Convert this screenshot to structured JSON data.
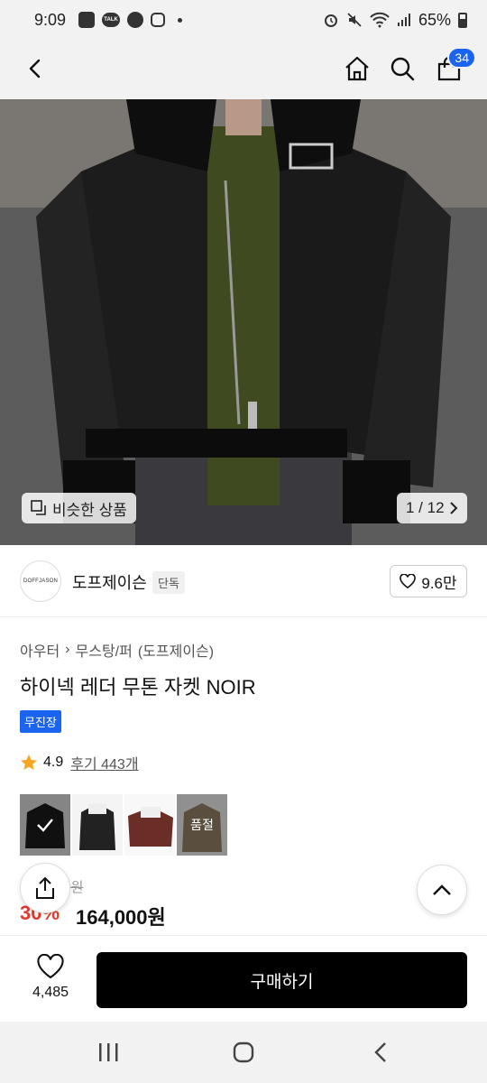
{
  "status": {
    "time": "9:09",
    "talk_label": "TALK",
    "battery": "65%"
  },
  "header": {
    "cart_count": "34"
  },
  "hero": {
    "similar_label": "비슷한 상품",
    "page_indicator": "1 / 12"
  },
  "brand": {
    "logo_text": "DOFFJASON",
    "name": "도프제이슨",
    "tag": "단독",
    "likes": "9.6만"
  },
  "product": {
    "breadcrumb": [
      "아우터",
      "무스탕/퍼",
      "(도프제이슨)"
    ],
    "title": "하이넥 레더 무톤 자켓 NOIR",
    "free_shipping": "무진장",
    "rating": "4.9",
    "reviews": "후기 443개",
    "sold_out_label": "품절",
    "original_price": "00원",
    "discount": "30%",
    "sale_price": "164,000원"
  },
  "bottom": {
    "wish_count": "4,485",
    "buy_label": "구매하기"
  },
  "colors": {
    "accent": "#1a64f0",
    "discount": "#e33b2c",
    "star": "#f5a623"
  }
}
